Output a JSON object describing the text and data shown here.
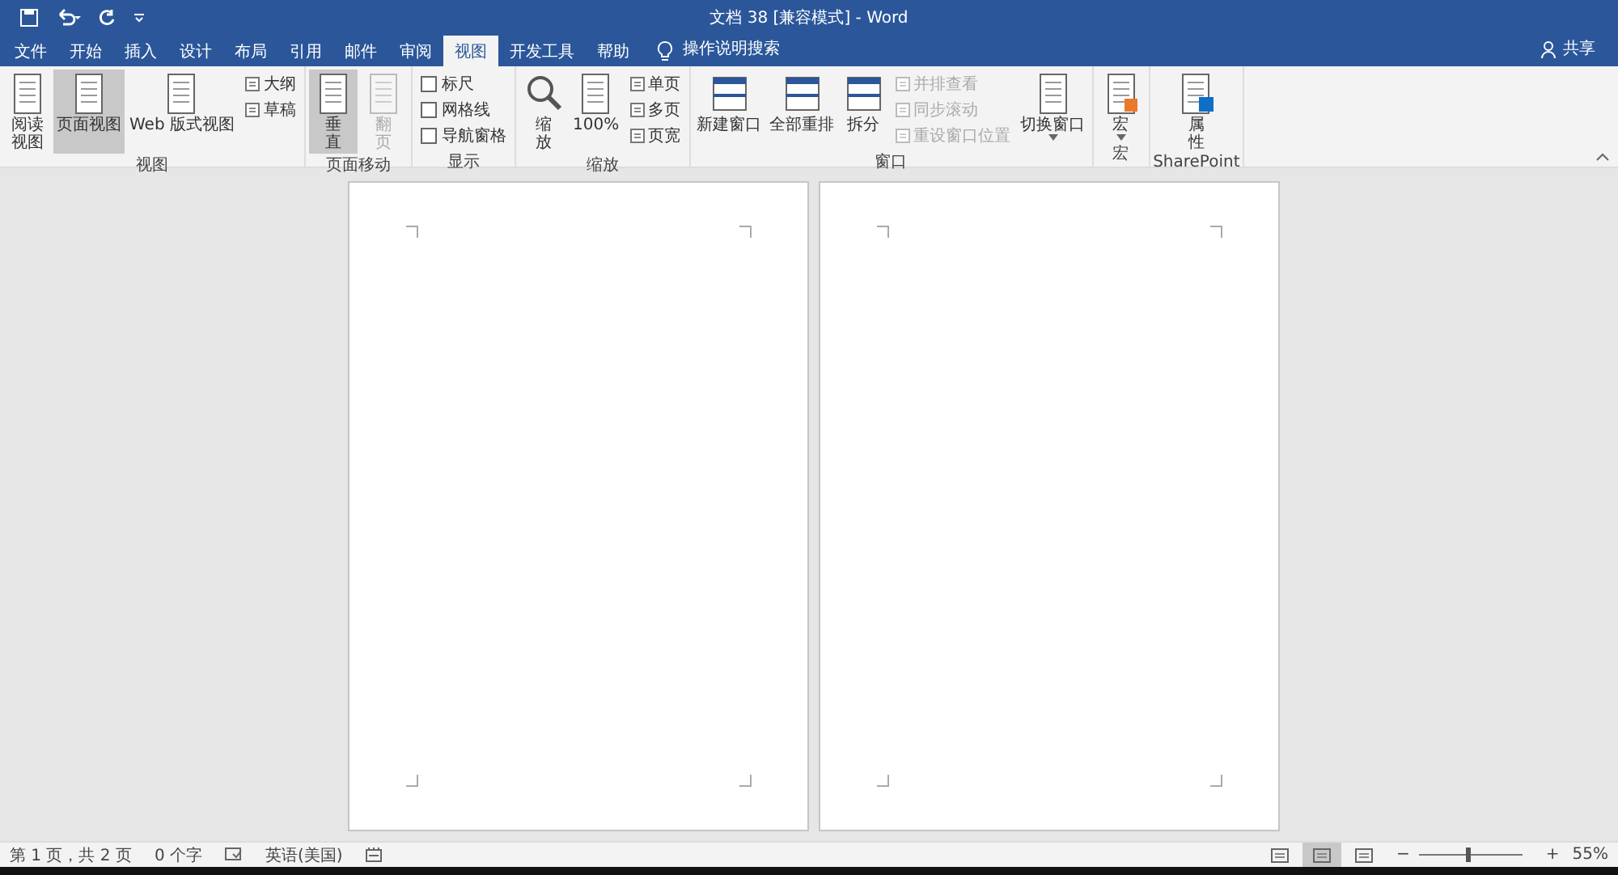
{
  "title": "文档 38 [兼容模式] - Word",
  "tabs": [
    {
      "label": "文件",
      "selected": false
    },
    {
      "label": "开始",
      "selected": false
    },
    {
      "label": "插入",
      "selected": false
    },
    {
      "label": "设计",
      "selected": false
    },
    {
      "label": "布局",
      "selected": false
    },
    {
      "label": "引用",
      "selected": false
    },
    {
      "label": "邮件",
      "selected": false
    },
    {
      "label": "审阅",
      "selected": false
    },
    {
      "label": "视图",
      "selected": true
    },
    {
      "label": "开发工具",
      "selected": false
    },
    {
      "label": "帮助",
      "selected": false
    }
  ],
  "tell_me": "操作说明搜索",
  "share": "共享",
  "groups": [
    {
      "label": "视图",
      "items": [
        {
          "kind": "large",
          "label": "阅读视图",
          "selected": false,
          "disabled": false
        },
        {
          "kind": "large",
          "label": "页面视图",
          "selected": true,
          "disabled": false
        },
        {
          "kind": "large",
          "label": "Web 版式视图",
          "selected": false,
          "disabled": false
        },
        {
          "kind": "stack",
          "items": [
            {
              "kind": "small",
              "label": "大纲",
              "disabled": false
            },
            {
              "kind": "small",
              "label": "草稿",
              "disabled": false
            }
          ]
        }
      ]
    },
    {
      "label": "页面移动",
      "items": [
        {
          "kind": "large",
          "label": "垂直",
          "selected": true,
          "disabled": false
        },
        {
          "kind": "large",
          "label": "翻页",
          "selected": false,
          "disabled": true
        }
      ]
    },
    {
      "label": "显示",
      "items": [
        {
          "kind": "stack",
          "items": [
            {
              "kind": "check",
              "label": "标尺",
              "checked": false
            },
            {
              "kind": "check",
              "label": "网格线",
              "checked": false
            },
            {
              "kind": "check",
              "label": "导航窗格",
              "checked": false
            }
          ]
        }
      ]
    },
    {
      "label": "缩放",
      "items": [
        {
          "kind": "large",
          "label": "缩放",
          "selected": false,
          "disabled": false
        },
        {
          "kind": "large",
          "label": "100%",
          "selected": false,
          "disabled": false
        },
        {
          "kind": "stack",
          "items": [
            {
              "kind": "small",
              "label": "单页",
              "disabled": false
            },
            {
              "kind": "small",
              "label": "多页",
              "disabled": false
            },
            {
              "kind": "small",
              "label": "页宽",
              "disabled": false
            }
          ]
        }
      ]
    },
    {
      "label": "窗口",
      "items": [
        {
          "kind": "large",
          "label": "新建窗口",
          "selected": false,
          "disabled": false
        },
        {
          "kind": "large",
          "label": "全部重排",
          "selected": false,
          "disabled": false
        },
        {
          "kind": "large",
          "label": "拆分",
          "selected": false,
          "disabled": false
        },
        {
          "kind": "stack",
          "items": [
            {
              "kind": "small",
              "label": "并排查看",
              "disabled": true
            },
            {
              "kind": "small",
              "label": "同步滚动",
              "disabled": true
            },
            {
              "kind": "small",
              "label": "重设窗口位置",
              "disabled": true
            }
          ]
        },
        {
          "kind": "large",
          "label": "切换窗口",
          "selected": false,
          "disabled": false,
          "dropdown": true
        }
      ]
    },
    {
      "label": "宏",
      "items": [
        {
          "kind": "large",
          "label": "宏",
          "selected": false,
          "disabled": false,
          "dropdown": true
        }
      ]
    },
    {
      "label": "SharePoint",
      "items": [
        {
          "kind": "large",
          "label": "属性",
          "selected": false,
          "disabled": false
        }
      ]
    }
  ],
  "status": {
    "page": "第 1 页，共 2 页",
    "words": "0 个字",
    "language": "英语(美国)",
    "views": [
      {
        "selected": false
      },
      {
        "selected": true
      },
      {
        "selected": false
      }
    ],
    "zoom_out": "−",
    "zoom_in": "+",
    "zoom": {
      "level": 0.45
    },
    "zoom_text": "55%"
  }
}
